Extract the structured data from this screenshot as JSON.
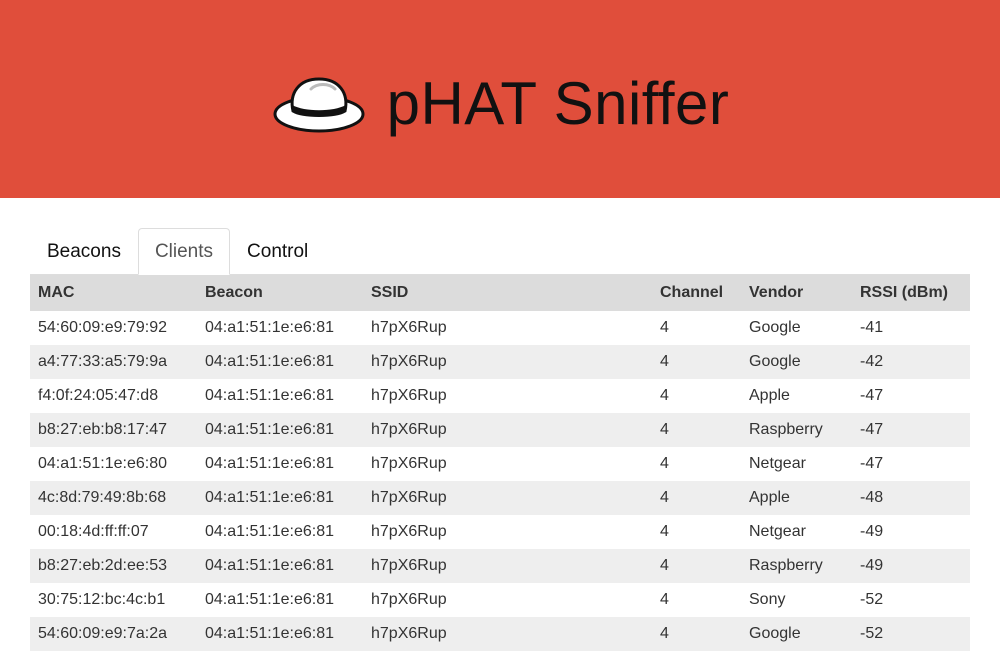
{
  "header": {
    "title": "pHAT Sniffer",
    "logo_icon": "fedora-hat-icon",
    "background": "#e04e3b"
  },
  "tabs": [
    {
      "label": "Beacons",
      "active": false
    },
    {
      "label": "Clients",
      "active": true
    },
    {
      "label": "Control",
      "active": false
    }
  ],
  "table": {
    "columns": [
      "MAC",
      "Beacon",
      "SSID",
      "Channel",
      "Vendor",
      "RSSI (dBm)"
    ],
    "rows": [
      [
        "54:60:09:e9:79:92",
        "04:a1:51:1e:e6:81",
        "h7pX6Rup",
        "4",
        "Google",
        "-41"
      ],
      [
        "a4:77:33:a5:79:9a",
        "04:a1:51:1e:e6:81",
        "h7pX6Rup",
        "4",
        "Google",
        "-42"
      ],
      [
        "f4:0f:24:05:47:d8",
        "04:a1:51:1e:e6:81",
        "h7pX6Rup",
        "4",
        "Apple",
        "-47"
      ],
      [
        "b8:27:eb:b8:17:47",
        "04:a1:51:1e:e6:81",
        "h7pX6Rup",
        "4",
        "Raspberry",
        "-47"
      ],
      [
        "04:a1:51:1e:e6:80",
        "04:a1:51:1e:e6:81",
        "h7pX6Rup",
        "4",
        "Netgear",
        "-47"
      ],
      [
        "4c:8d:79:49:8b:68",
        "04:a1:51:1e:e6:81",
        "h7pX6Rup",
        "4",
        "Apple",
        "-48"
      ],
      [
        "00:18:4d:ff:ff:07",
        "04:a1:51:1e:e6:81",
        "h7pX6Rup",
        "4",
        "Netgear",
        "-49"
      ],
      [
        "b8:27:eb:2d:ee:53",
        "04:a1:51:1e:e6:81",
        "h7pX6Rup",
        "4",
        "Raspberry",
        "-49"
      ],
      [
        "30:75:12:bc:4c:b1",
        "04:a1:51:1e:e6:81",
        "h7pX6Rup",
        "4",
        "Sony",
        "-52"
      ],
      [
        "54:60:09:e9:7a:2a",
        "04:a1:51:1e:e6:81",
        "h7pX6Rup",
        "4",
        "Google",
        "-52"
      ]
    ]
  }
}
